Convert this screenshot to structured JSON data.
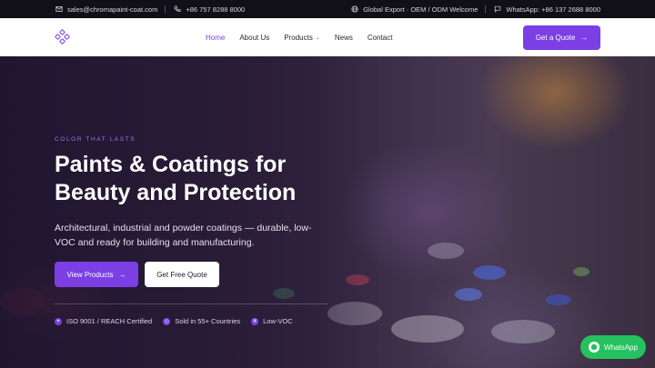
{
  "topbar": {
    "email": "sales@chromapaint-coat.com",
    "phone": "+86 757 8288 8000",
    "tagline": "Global Export · OEM / ODM Welcome",
    "whatsapp": "WhatsApp: +86 137 2688 8000",
    "icons": [
      "mail-icon",
      "phone-icon",
      "globe-icon",
      "chat-icon"
    ]
  },
  "nav": {
    "items": [
      {
        "label": "Home",
        "active": true
      },
      {
        "label": "About Us",
        "active": false
      },
      {
        "label": "Products",
        "active": false,
        "dropdown": true
      },
      {
        "label": "News",
        "active": false
      },
      {
        "label": "Contact",
        "active": false
      }
    ],
    "cta": "Get a Quote"
  },
  "hero": {
    "eyebrow": "COLOR THAT LASTS",
    "headline": "Paints & Coatings for Beauty and Protection",
    "subtitle": "Architectural, industrial and powder coatings — durable, low-VOC and ready for building and manufacturing.",
    "primary_button": "View Products",
    "secondary_button": "Get Free Quote",
    "badges": [
      "ISO 9001 / REACH Certified",
      "Sold in 55+ Countries",
      "Low-VOC"
    ]
  },
  "whatsapp_button": "WhatsApp",
  "colors": {
    "accent": "#7b3fe4",
    "whatsapp": "#25c15e",
    "topbar": "#111018"
  }
}
